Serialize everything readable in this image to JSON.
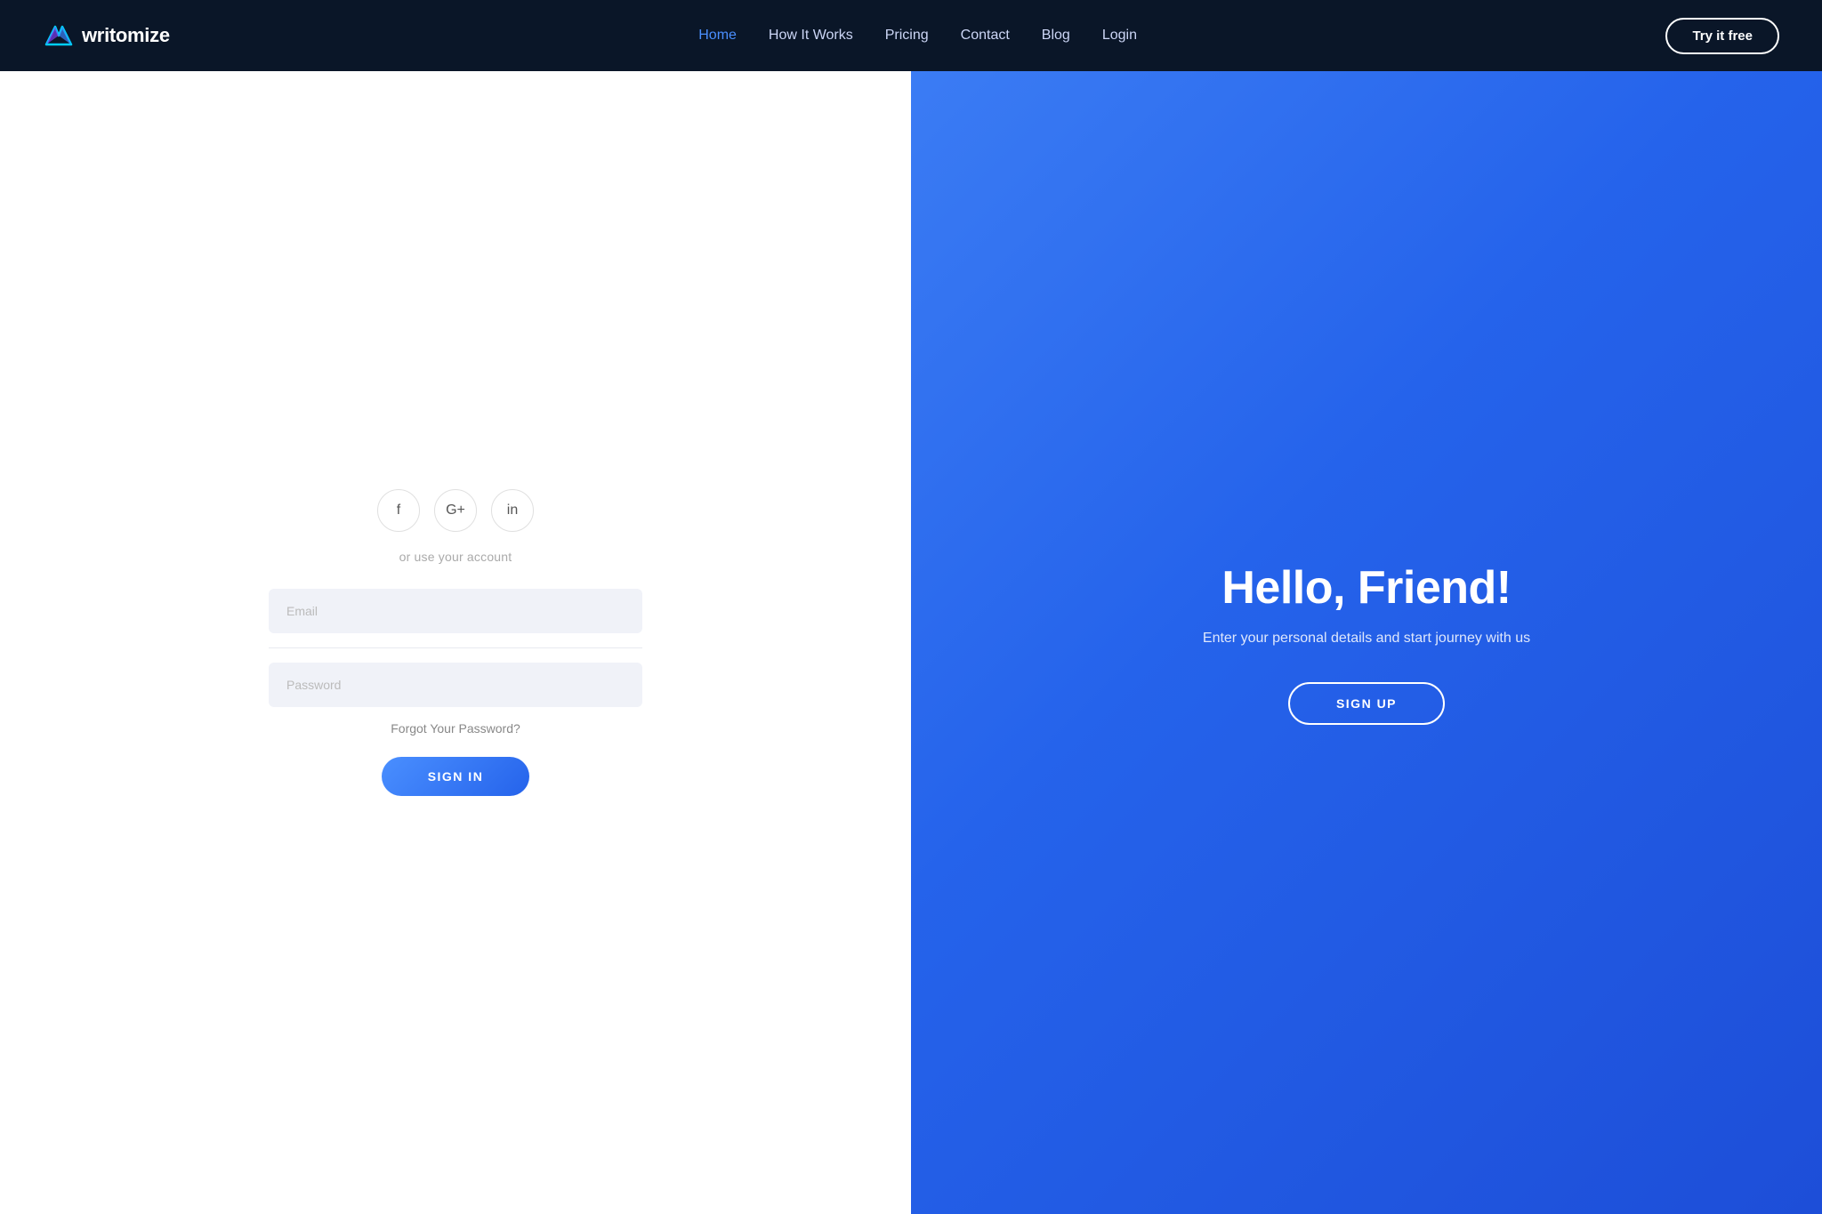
{
  "navbar": {
    "brand": {
      "name": "writomize"
    },
    "nav_items": [
      {
        "label": "Home",
        "active": true
      },
      {
        "label": "How It Works",
        "active": false
      },
      {
        "label": "Pricing",
        "active": false
      },
      {
        "label": "Contact",
        "active": false
      },
      {
        "label": "Blog",
        "active": false
      },
      {
        "label": "Login",
        "active": false
      }
    ],
    "cta_button": "Try it free"
  },
  "left_panel": {
    "social_icons": [
      {
        "name": "facebook",
        "symbol": "f"
      },
      {
        "name": "google-plus",
        "symbol": "G+"
      },
      {
        "name": "linkedin",
        "symbol": "in"
      }
    ],
    "or_use_account": "or use your account",
    "email_placeholder": "Email",
    "password_placeholder": "Password",
    "forgot_password": "Forgot Your Password?",
    "sign_in_button": "SIGN IN"
  },
  "right_panel": {
    "heading": "Hello, Friend!",
    "subtext": "Enter your personal details and start journey with us",
    "sign_up_button": "SIGN UP"
  }
}
